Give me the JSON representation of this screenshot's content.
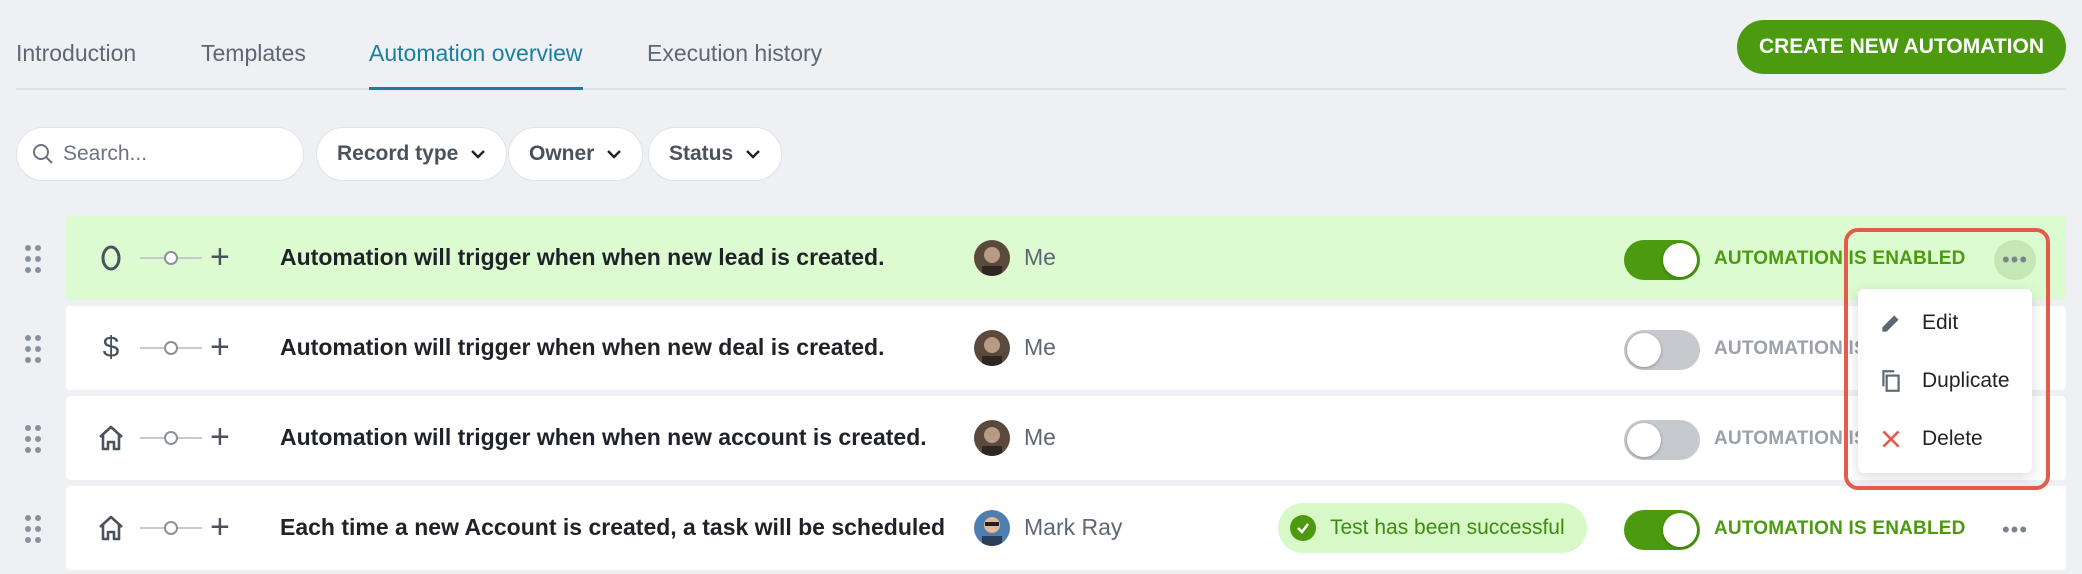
{
  "tabs": [
    {
      "label": "Introduction"
    },
    {
      "label": "Templates"
    },
    {
      "label": "Automation overview"
    },
    {
      "label": "Execution history"
    }
  ],
  "create_button": "CREATE NEW AUTOMATION",
  "search": {
    "placeholder": "Search..."
  },
  "filters": [
    {
      "label": "Record type"
    },
    {
      "label": "Owner"
    },
    {
      "label": "Status"
    }
  ],
  "rows": [
    {
      "trigger_icon": "lead-icon",
      "description": "Automation will trigger when when new lead is created.",
      "owner": "Me",
      "enabled": true,
      "status": "AUTOMATION IS ENABLED",
      "test": ""
    },
    {
      "trigger_icon": "dollar-icon",
      "description": "Automation will trigger when when new deal is created.",
      "owner": "Me",
      "enabled": false,
      "status": "AUTOMATION IS",
      "test": ""
    },
    {
      "trigger_icon": "home-icon",
      "description": "Automation will trigger when when new account is created.",
      "owner": "Me",
      "enabled": false,
      "status": "AUTOMATION IS",
      "test": ""
    },
    {
      "trigger_icon": "home-icon",
      "description": "Each time a new Account is created, a task will be scheduled",
      "owner": "Mark Ray",
      "enabled": true,
      "status": "AUTOMATION IS ENABLED",
      "test": "Test has been successful"
    }
  ],
  "menu": {
    "items": [
      {
        "label": "Edit",
        "icon": "pencil-icon"
      },
      {
        "label": "Duplicate",
        "icon": "copy-icon"
      },
      {
        "label": "Delete",
        "icon": "close-icon"
      }
    ]
  },
  "colors": {
    "accent": "#1a7f9f",
    "primary_green": "#4b9a0f",
    "row_highlight": "#dcfbd0",
    "delete_red": "#e35b4a"
  }
}
